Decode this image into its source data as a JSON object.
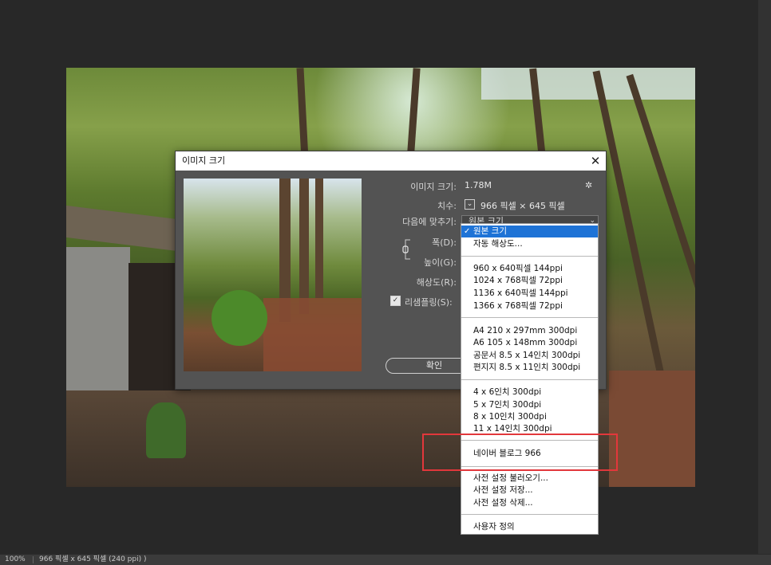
{
  "dialog": {
    "title": "이미지 크기",
    "image_size_label": "이미지 크기:",
    "image_size_value": "1.78M",
    "dimensions_label": "치수:",
    "dimensions_value": "966 픽셀 × 645 픽셀",
    "fit_to_label": "다음에 맞추기:",
    "fit_to_value": "원본 크기",
    "width_label": "폭(D):",
    "height_label": "높이(G):",
    "resolution_label": "해상도(R):",
    "resample_label": "리샘플링(S):",
    "ok_label": "확인"
  },
  "fit_menu": {
    "items": [
      {
        "label": "원본 크기",
        "selected": true
      },
      {
        "label": "자동 해상도..."
      },
      {
        "label": "960 x 640픽셀 144ppi"
      },
      {
        "label": "1024 x 768픽셀 72ppi"
      },
      {
        "label": "1136 x 640픽셀 144ppi"
      },
      {
        "label": "1366 x 768픽셀 72ppi"
      },
      {
        "label": "A4 210 x 297mm 300dpi"
      },
      {
        "label": "A6 105 x 148mm 300dpi"
      },
      {
        "label": "공문서 8.5 x 14인치 300dpi"
      },
      {
        "label": "편지지 8.5 x 11인치 300dpi"
      },
      {
        "label": "4 x 6인치 300dpi"
      },
      {
        "label": "5 x 7인치 300dpi"
      },
      {
        "label": "8 x 10인치 300dpi"
      },
      {
        "label": "11 x 14인치 300dpi"
      },
      {
        "label": "네이버 블로그 966"
      },
      {
        "label": "사전 설정 불러오기..."
      },
      {
        "label": "사전 설정 저장..."
      },
      {
        "label": "사전 설정 삭제..."
      },
      {
        "label": "사용자 정의"
      }
    ]
  },
  "status_bar": {
    "zoom": "100%",
    "info": "966 픽셀 x 645 픽셀 (240 ppi)",
    "more": ")"
  },
  "colors": {
    "menu_selected": "#1e73d6",
    "highlight_box": "#e2373b",
    "workspace_bg": "#282828",
    "dialog_bg": "#535353"
  }
}
